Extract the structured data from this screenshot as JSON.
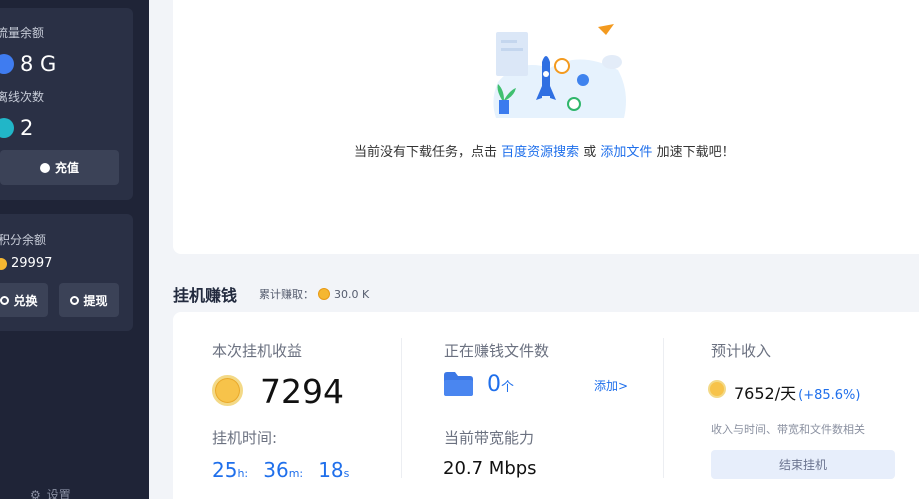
{
  "sidebar": {
    "flow_label": "流量余额",
    "flow_value": "8 G",
    "times_label": "离线次数",
    "times_value": "2",
    "recharge_label": "充值",
    "points_label": "积分余额",
    "points_value": "29997",
    "exchange_label": "兑换",
    "withdraw_label": "提现",
    "settings_label": "设置"
  },
  "empty_state": {
    "text_before": "当前没有下载任务，点击 ",
    "link_search": "百度资源搜索",
    "text_or": " 或 ",
    "link_add": "添加文件",
    "text_after": " 加速下载吧！"
  },
  "earn": {
    "title": "挂机赚钱",
    "total_label": "累计赚取：",
    "total_value": "30.0 K",
    "session_label": "本次挂机收益",
    "session_value": "7294",
    "time_label": "挂机时间:",
    "time": {
      "h": "25",
      "h_unit": "h:",
      "m": "36",
      "m_unit": "m:",
      "s": "18",
      "s_unit": "s"
    },
    "files_label": "正在赚钱文件数",
    "files_value": "0",
    "files_unit": "个",
    "add_link": "添加>",
    "bandwidth_label": "当前带宽能力",
    "bandwidth_value": "20.7 Mbps",
    "estimate_label": "预计收入",
    "estimate_value": "7652/天",
    "estimate_change": "(+85.6%)",
    "note": "收入与时间、带宽和文件数相关",
    "end_button": "结束挂机"
  },
  "colors": {
    "sidebar_bg": "#1f2437",
    "card_bg": "#2a3045",
    "accent_blue": "#1f6feb",
    "coin_gold": "#f7c34a"
  }
}
